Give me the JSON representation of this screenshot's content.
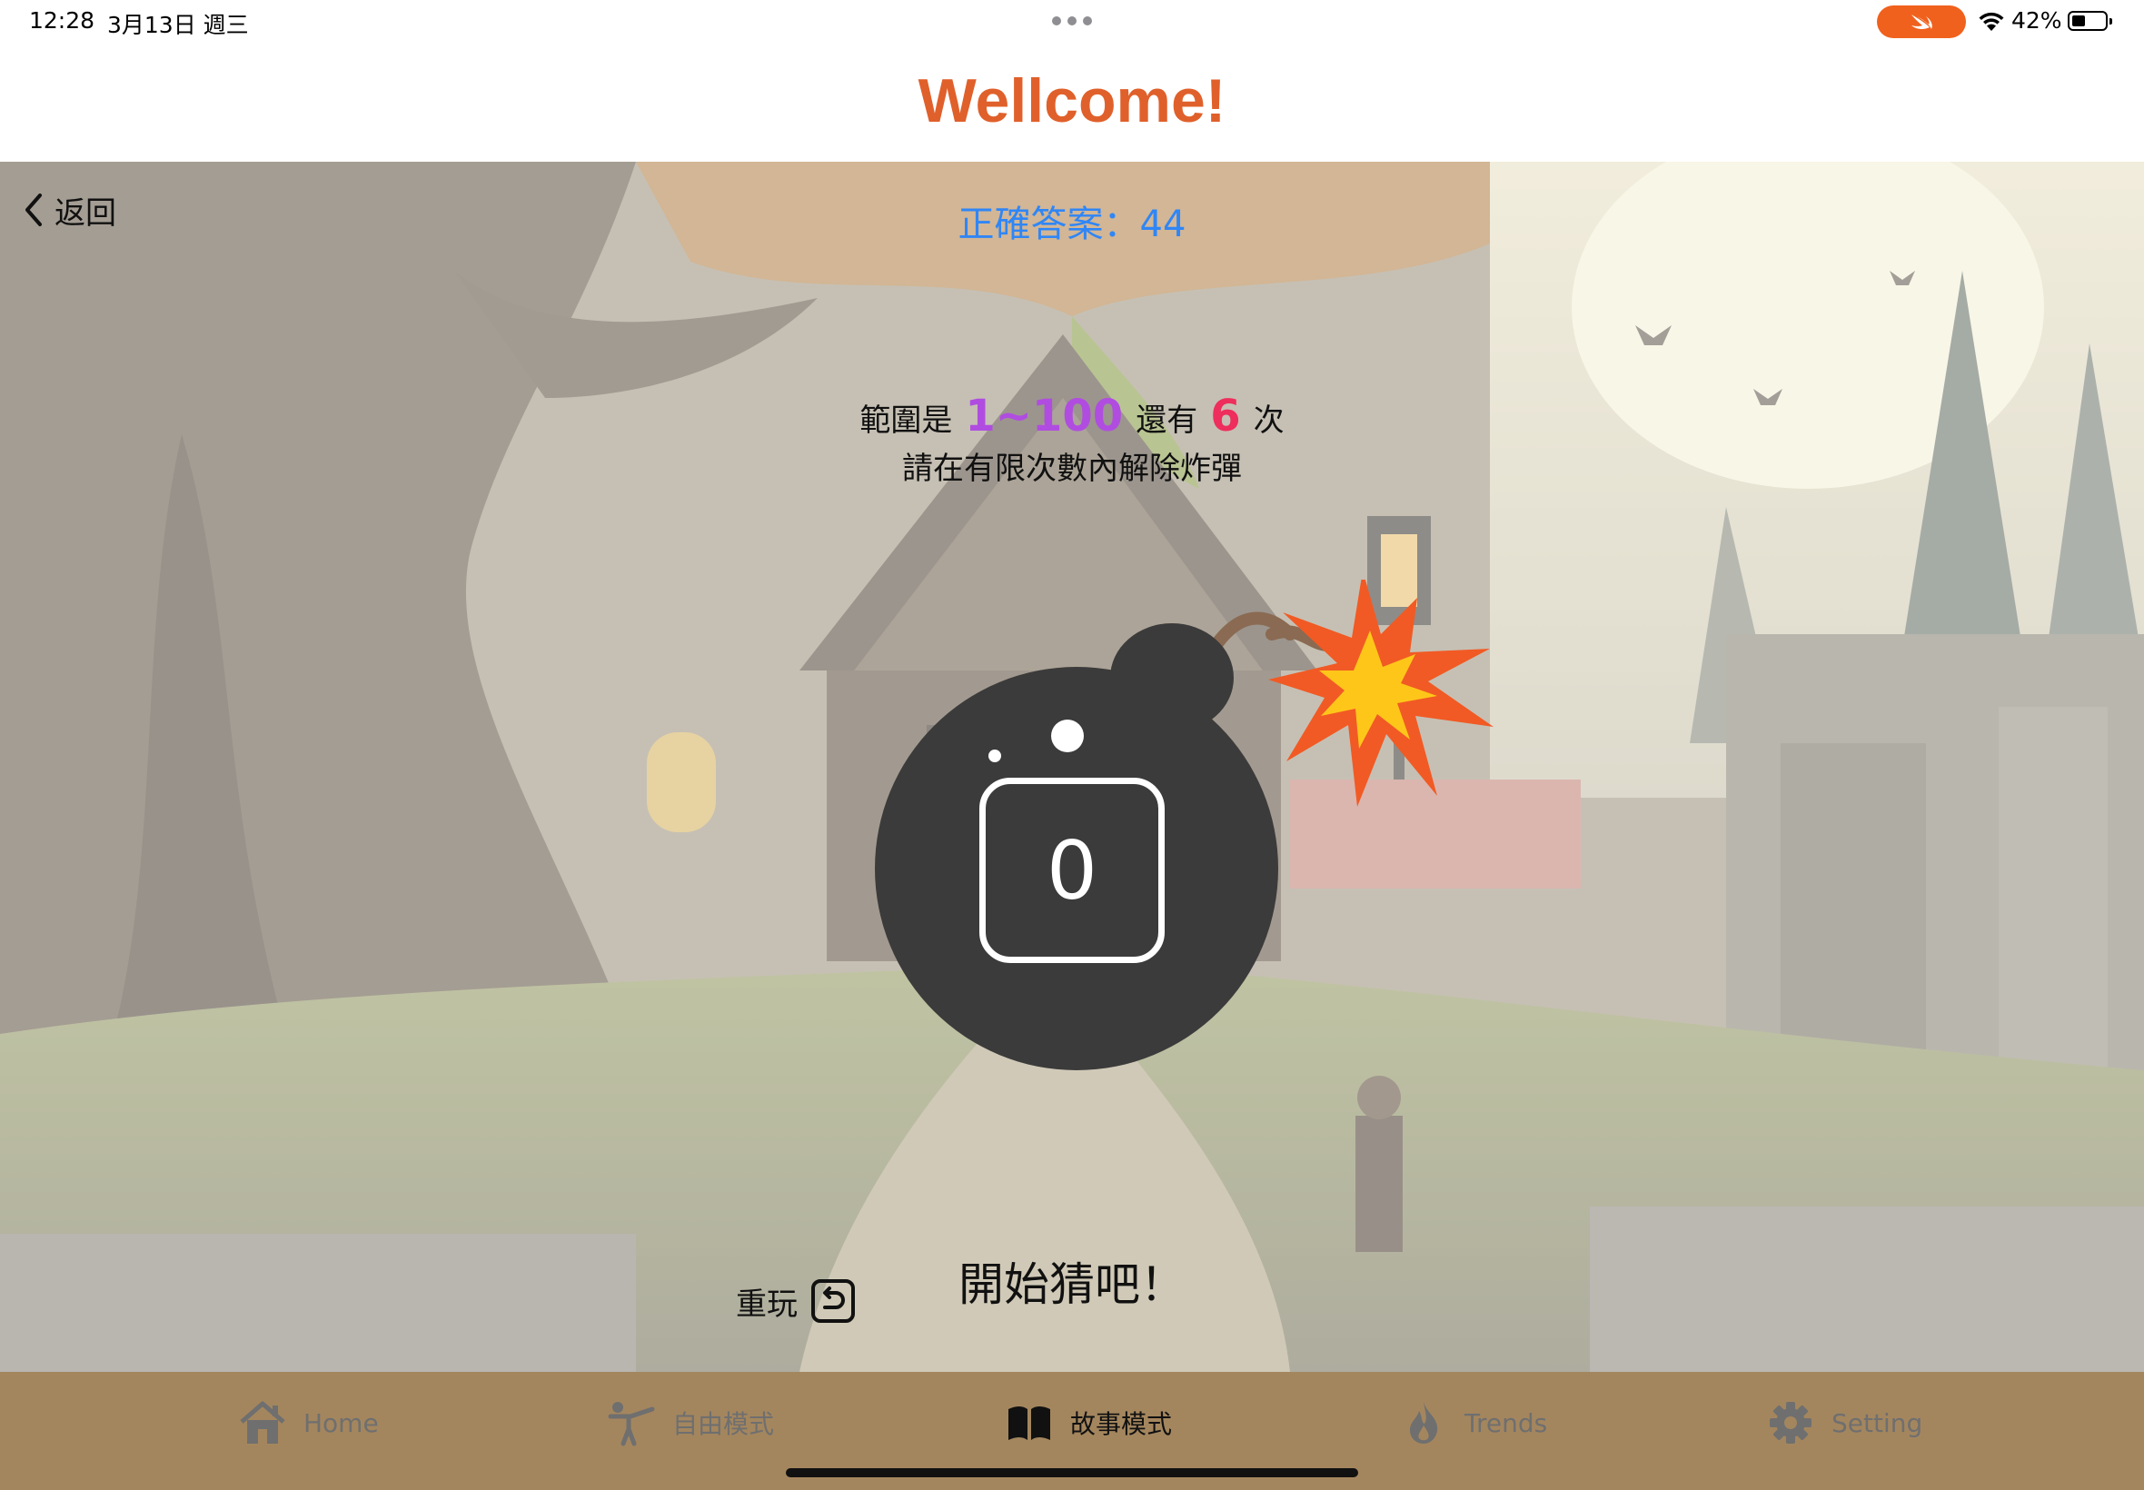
{
  "status_bar": {
    "time": "12:28",
    "date": "3月13日 週三",
    "battery": "42%",
    "battery_level": 0.42,
    "accent_color": "#f0611d"
  },
  "nav": {
    "title": "Wellcome!",
    "title_color": "#e0602b"
  },
  "game": {
    "back_label": "返回",
    "answer_label": "正確答案：44",
    "range_prefix": "範圍是",
    "range_value": "1~100",
    "tries_prefix": "還有",
    "tries_value": "6",
    "tries_suffix": "次",
    "hint": "請在有限次數內解除炸彈",
    "guess_value": "0",
    "replay_label": "重玩",
    "prompt": "開始猜吧！",
    "colors": {
      "answer": "#2f86f6",
      "range": "#b04de0",
      "tries": "#ee2e5c"
    }
  },
  "tabs": [
    {
      "label": "Home",
      "icon": "house-icon",
      "active": false
    },
    {
      "label": "自由模式",
      "icon": "kick-figure-icon",
      "active": false
    },
    {
      "label": "故事模式",
      "icon": "book-icon",
      "active": true
    },
    {
      "label": "Trends",
      "icon": "flame-icon",
      "active": false
    },
    {
      "label": "Setting",
      "icon": "gear-icon",
      "active": false
    }
  ]
}
